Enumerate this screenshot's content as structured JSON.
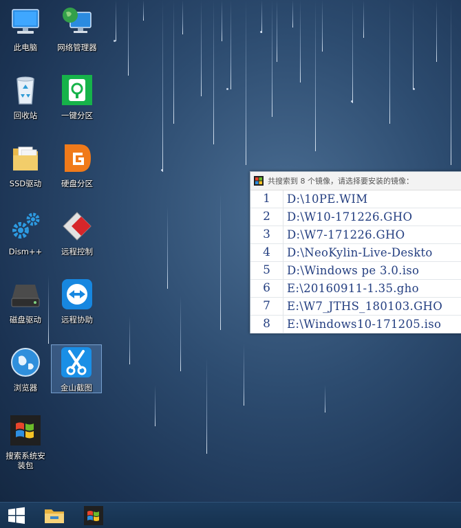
{
  "desktop": {
    "icons": [
      {
        "label": "此电脑",
        "icon": "computer-icon"
      },
      {
        "label": "网络管理器",
        "icon": "network-manager-icon"
      },
      {
        "label": "回收站",
        "icon": "recycle-bin-icon"
      },
      {
        "label": "一键分区",
        "icon": "one-key-partition-icon"
      },
      {
        "label": "SSD驱动",
        "icon": "folder-icon"
      },
      {
        "label": "硬盘分区",
        "icon": "diskgenius-icon"
      },
      {
        "label": "Dism++",
        "icon": "gears-icon"
      },
      {
        "label": "远程控制",
        "icon": "remote-control-icon"
      },
      {
        "label": "磁盘驱动",
        "icon": "disk-drive-icon"
      },
      {
        "label": "远程协助",
        "icon": "teamviewer-icon"
      },
      {
        "label": "浏览器",
        "icon": "browser-globe-icon"
      },
      {
        "label": "金山截图",
        "icon": "screenshot-scissors-icon"
      },
      {
        "label": "搜索系统安装包",
        "icon": "windows-flag-icon"
      }
    ]
  },
  "dialog": {
    "title": "共搜索到 8 个镜像，请选择要安装的镜像：",
    "rows": [
      {
        "num": "1",
        "path": "D:\\10PE.WIM"
      },
      {
        "num": "2",
        "path": "D:\\W10-171226.GHO"
      },
      {
        "num": "3",
        "path": "D:\\W7-171226.GHO"
      },
      {
        "num": "4",
        "path": "D:\\NeoKylin-Live-Deskto"
      },
      {
        "num": "5",
        "path": "D:\\Windows pe 3.0.iso"
      },
      {
        "num": "6",
        "path": "E:\\20160911-1.35.gho"
      },
      {
        "num": "7",
        "path": "E:\\W7_JTHS_180103.GHO"
      },
      {
        "num": "8",
        "path": "E:\\Windows10-171205.iso"
      }
    ]
  },
  "taskbar": {
    "items": [
      {
        "icon": "windows-start-icon"
      },
      {
        "icon": "file-explorer-icon"
      },
      {
        "icon": "windows-flag-app-icon"
      }
    ]
  },
  "colors": {
    "desktop_bg": "#2d4c70",
    "taskbar_bg": "#1d3d5f",
    "list_text": "#233e80",
    "selection": "#78aae6"
  }
}
